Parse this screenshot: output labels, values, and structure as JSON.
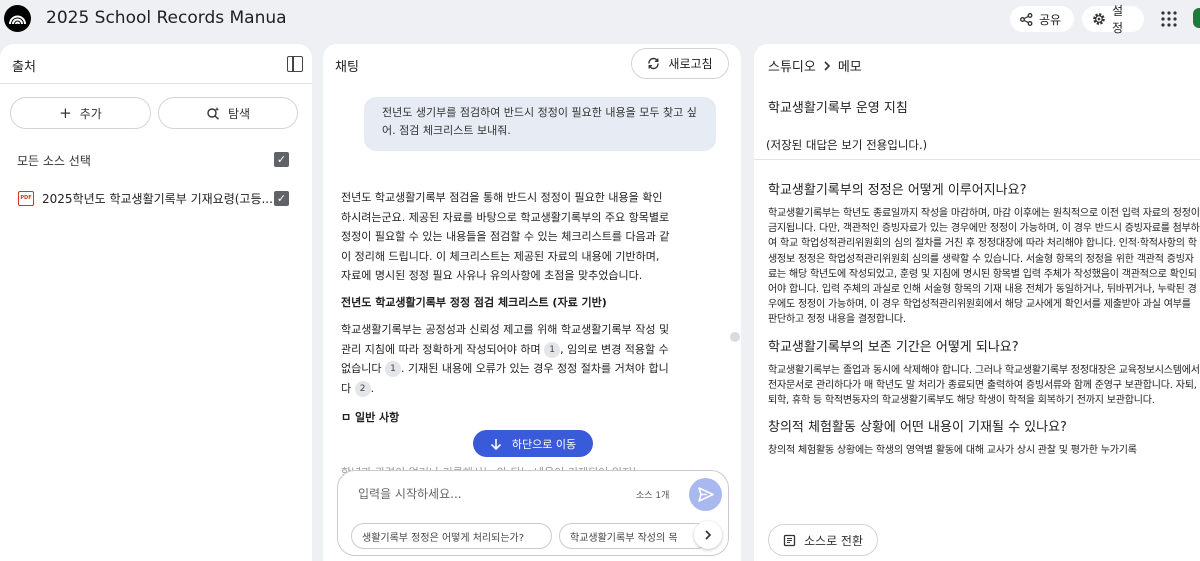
{
  "app": {
    "title": "2025 School Records Manua"
  },
  "header": {
    "share_label": "공유",
    "settings_label": "설정"
  },
  "sources": {
    "title": "출처",
    "add_label": "추가",
    "explore_label": "탐색",
    "select_all_label": "모든 소스 선택",
    "items": [
      {
        "label": "2025학년도 학교생활기록부 기재요령(고등...",
        "checked": true
      }
    ]
  },
  "chat": {
    "title": "채팅",
    "refresh_label": "새로고침",
    "user_message": "전년도 생기부를 점검하여 반드시 정정이 필요한 내용을 모두 찾고 싶어. 점검 체크리스트 보내줘.",
    "intro": "전년도 학교생활기록부 점검을 통해 반드시 정정이 필요한 내용을 확인하시려는군요. 제공된 자료를 바탕으로 학교생활기록부의 주요 항목별로 정정이 필요할 수 있는 내용들을 점검할 수 있는 체크리스트를 다음과 같이 정리해 드립니다. 이 체크리스트는 제공된 자료의 내용에 기반하며, 자료에 명시된 정정 필요 사유나 유의사항에 초점을 맞추었습니다.",
    "checklist_heading": "전년도 학교생활기록부 정정 점검 체크리스트 (자료 기반)",
    "para_a": "학교생활기록부는 공정성과 신뢰성 제고를 위해 학교생활기록부 작성 및 관리 지침에 따라 정확하게 작성되어야 하며",
    "para_b": ", 임의로 변경 적용할 수 없습니다",
    "para_c": ". 기재된 내용에 오류가 있는 경우 정정 절차를 거쳐야 합니다",
    "para_d": ".",
    "cite_1": "1",
    "cite_2": "2",
    "general_heading": "ㅁ 일반 사항",
    "faded_text": "학년과 관련이 없거나 기록해서는 안 되는 내용이 기재되어 있지는",
    "jump_label": "하단으로 이동",
    "input_placeholder": "입력을 시작하세요...",
    "source_count": "소스 1개",
    "suggestions": [
      "생활기록부 정정은 어떻게 처리되는가?",
      "학교생활기록부 작성의 목"
    ]
  },
  "studio": {
    "breadcrumb_root": "스튜디오",
    "breadcrumb_current": "메모",
    "note_title": "학교생활기록부 운영 지침",
    "readonly_notice": "(저장된 대답은 보기 전용입니다.)",
    "sections": [
      {
        "heading": "학교생활기록부의 정정은 어떻게 이루어지나요?",
        "body": "학교생활기록부는 학년도 종료일까지 작성을 마감하며, 마감 이후에는 원칙적으로 이전 입력 자료의 정정이 금지됩니다. 다만, 객관적인 증빙자료가 있는 경우에만 정정이 가능하며, 이 경우 반드시 증빙자료를 첨부하여 학교 학업성적관리위원회의 심의 절차를 거친 후 정정대장에 따라 처리해야 합니다. 인적·학적사항의 학생정보 정정은 학업성적관리위원회 심의를 생략할 수 있습니다. 서술형 항목의 정정을 위한 객관적 증빙자료는 해당 학년도에 작성되었고, 훈령 및 지침에 명시된 항목별 입력 주체가 작성했음이 객관적으로 확인되어야 합니다. 입력 주체의 과실로 인해 서술형 항목의 기재 내용 전체가 동일하거나, 뒤바뀌거나, 누락된 경우에도 정정이 가능하며, 이 경우 학업성적관리위원회에서 해당 교사에게 확인서를 제출받아 과실 여부를 판단하고 정정 내용을 결정합니다."
      },
      {
        "heading": "학교생활기록부의 보존 기간은 어떻게 되나요?",
        "body": "학교생활기록부는 졸업과 동시에 삭제해야 합니다. 그러나 학교생활기록부 정정대장은 교육정보시스템에서 전자문서로 관리하다가 매 학년도 말 처리가 종료되면 출력하여 증빙서류와 함께 준영구 보관합니다. 자퇴, 퇴학, 휴학 등 학적변동자의 학교생활기록부도 해당 학생이 학적을 회복하기 전까지 보관합니다."
      },
      {
        "heading": "창의적 체험활동 상황에 어떤 내용이 기재될 수 있나요?",
        "body": "창의적 체험활동 상황에는 학생의 영역별 활동에 대해 교사가 상시 관찰 및 평가한 누가기록"
      }
    ],
    "convert_label": "소스로 전환"
  }
}
